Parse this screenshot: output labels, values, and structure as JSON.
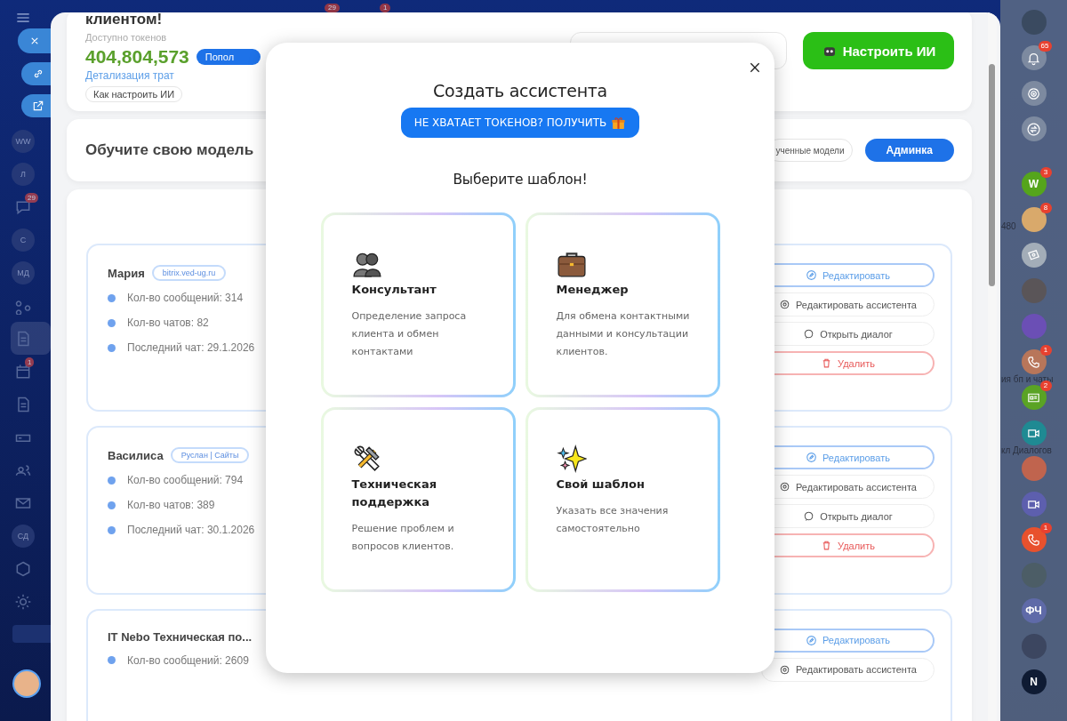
{
  "top_bar": {
    "badges": [
      "29",
      "1"
    ]
  },
  "left_nav": {
    "items": [
      {
        "kind": "avatar",
        "initials": "WW",
        "selected": false
      },
      {
        "kind": "avatar",
        "initials": "Л",
        "selected": false
      },
      {
        "kind": "chat",
        "badge": "29",
        "selected": false
      },
      {
        "kind": "avatar",
        "initials": "С",
        "selected": false
      },
      {
        "kind": "avatar",
        "initials": "МД",
        "selected": false
      },
      {
        "kind": "flow",
        "selected": false
      },
      {
        "kind": "doc",
        "selected": true
      },
      {
        "kind": "calendar",
        "badge": "1",
        "selected": false
      },
      {
        "kind": "doc",
        "selected": false
      },
      {
        "kind": "drive",
        "selected": false
      },
      {
        "kind": "group",
        "selected": false
      },
      {
        "kind": "mail",
        "selected": false
      },
      {
        "kind": "avatar",
        "initials": "СД",
        "selected": false
      },
      {
        "kind": "hexagon",
        "selected": false
      },
      {
        "kind": "gear",
        "selected": false
      }
    ]
  },
  "float_buttons": [
    {
      "kind": "close"
    },
    {
      "kind": "link"
    },
    {
      "kind": "external"
    }
  ],
  "panel": {
    "balance_card": {
      "title": "клиентом!",
      "tokens_label": "Доступно токенов",
      "tokens": "404,804,573",
      "topup": "Попол",
      "details_link": "Детализация трат",
      "help_chip": "Как настроить ИИ",
      "setup_button": "Настроить ИИ"
    },
    "train_card": {
      "title": "Обучите свою модель",
      "models_button": "ученные модели",
      "admin_button": "Админка"
    },
    "assistants": [
      {
        "name": "Мария",
        "tag": "bitrix.ved-ug.ru",
        "stats": [
          "Кол-во сообщений: 314",
          "Кол-во чатов: 82",
          "Последний чат: 29.1.2026"
        ],
        "actions": [
          {
            "kind": "primary",
            "label": "Редактировать"
          },
          {
            "kind": "default",
            "label": "Редактировать ассистента"
          },
          {
            "kind": "default",
            "label": "Открыть диалог"
          },
          {
            "kind": "danger",
            "label": "Удалить"
          }
        ]
      },
      {
        "name": "Василиса",
        "tag": "Руслан | Сайты",
        "stats": [
          "Кол-во сообщений: 794",
          "Кол-во чатов: 389",
          "Последний чат: 30.1.2026"
        ],
        "actions": [
          {
            "kind": "primary",
            "label": "Редактировать"
          },
          {
            "kind": "default",
            "label": "Редактировать ассистента"
          },
          {
            "kind": "default",
            "label": "Открыть диалог"
          },
          {
            "kind": "danger",
            "label": "Удалить"
          }
        ]
      },
      {
        "name": "IT Nebo Техническая по...",
        "stats": [
          "Кол-во сообщений: 2609"
        ],
        "actions": [
          {
            "kind": "primary",
            "label": "Редактировать"
          },
          {
            "kind": "default",
            "label": "Редактировать ассистента"
          }
        ]
      }
    ]
  },
  "right_bar": {
    "peek_labels": [
      "480",
      "ия бп и чаты",
      "кл Диалогов"
    ],
    "items": [
      {
        "kind": "photo",
        "color": "#3a4a60"
      },
      {
        "kind": "bell",
        "color": "#7d8aa0",
        "badge": "65"
      },
      {
        "kind": "target",
        "color": "#7d8aa0"
      },
      {
        "kind": "swap",
        "color": "#7d8aa0"
      },
      {
        "kind": "letter",
        "text": "W",
        "color": "#55a51c",
        "badge": "3"
      },
      {
        "kind": "photo",
        "color": "#d9a96b",
        "badge": "8"
      },
      {
        "kind": "money",
        "color": "#a3adb8"
      },
      {
        "kind": "photo",
        "color": "#5a5558"
      },
      {
        "kind": "photo",
        "color": "#6b4fb5"
      },
      {
        "kind": "phone",
        "color": "#b8765a",
        "badge": "1"
      },
      {
        "kind": "card",
        "color": "#5aa324",
        "badge": "2"
      },
      {
        "kind": "video",
        "color": "#1f8a93"
      },
      {
        "kind": "photo",
        "color": "#c0644e"
      },
      {
        "kind": "video",
        "color": "#5d5fae"
      },
      {
        "kind": "phone",
        "color": "#e8512d",
        "badge": "1"
      },
      {
        "kind": "photo",
        "color": "#4c5d66"
      },
      {
        "kind": "letter",
        "text": "ФЧ",
        "color": "#5f6aa8"
      },
      {
        "kind": "photo",
        "color": "#3c4660"
      },
      {
        "kind": "letter",
        "text": "N",
        "color": "#0f1b33"
      }
    ]
  },
  "modal": {
    "title": "Создать ассистента",
    "token_button": "НЕ ХВАТАЕТ ТОКЕНОВ? ПОЛУЧИТЬ",
    "subtitle": "Выберите шаблон!",
    "templates": [
      {
        "kind": "people",
        "title": "Консультант",
        "description": "Определение запроса клиента и обмен контактами"
      },
      {
        "kind": "briefcase",
        "title": "Менеджер",
        "description": "Для обмена контактными данными и консультации клиентов."
      },
      {
        "kind": "tools",
        "title": "Техническая поддержка",
        "description": "Решение проблем и вопросов клиентов."
      },
      {
        "kind": "sparkles",
        "title": "Свой шаблон",
        "description": "Указать все значения самостоятельно"
      }
    ]
  }
}
